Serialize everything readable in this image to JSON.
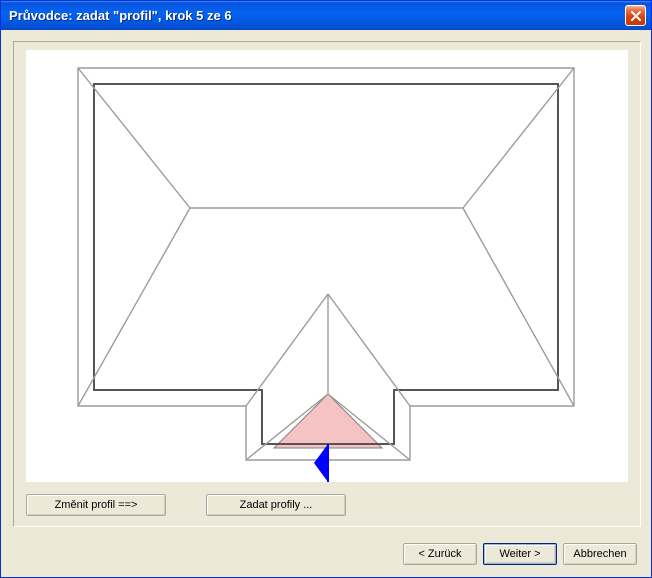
{
  "window": {
    "title": "Průvodce: zadat \"profil\", krok 5 ze 6"
  },
  "inner_buttons": {
    "change_profile": "Změnit profil  ==>",
    "enter_profiles": "Zadat profily ..."
  },
  "wizard_nav": {
    "back": "< Zurück",
    "next": "Weiter >",
    "cancel": "Abbrechen"
  },
  "colors": {
    "highlight_fill": "#f6c3c4",
    "highlight_stroke": "#808080",
    "arrow": "#0000ff",
    "outline_dark": "#555555",
    "outline_light": "#9c9c9c"
  }
}
